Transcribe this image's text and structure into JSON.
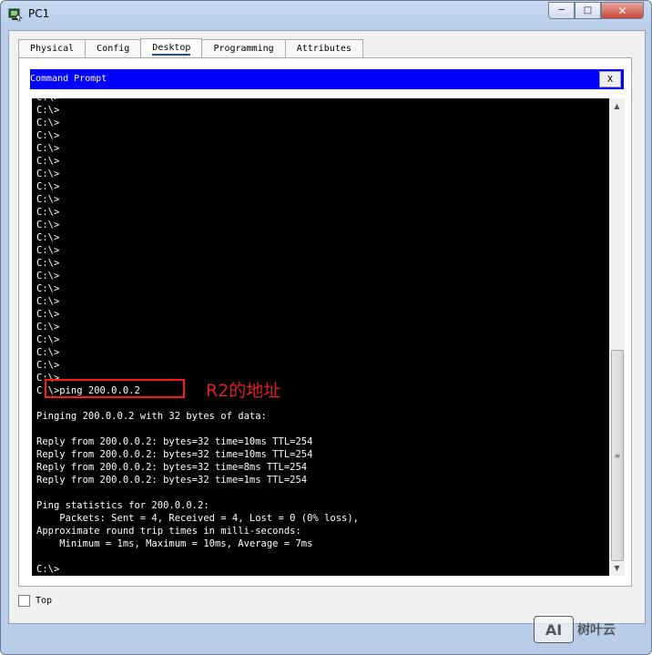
{
  "window": {
    "title": "PC1",
    "minimize": "─",
    "maximize": "□",
    "close": "✕",
    "icon": "packet-tracer-pc-icon"
  },
  "tabs": [
    {
      "label": "Physical",
      "active": false
    },
    {
      "label": "Config",
      "active": false
    },
    {
      "label": "Desktop",
      "active": true
    },
    {
      "label": "Programming",
      "active": false
    },
    {
      "label": "Attributes",
      "active": false
    }
  ],
  "command_prompt": {
    "title": "Command Prompt",
    "close_label": "X",
    "lines": [
      "C:\\>",
      "C:\\>",
      "C:\\>",
      "C:\\>",
      "C:\\>",
      "C:\\>",
      "C:\\>",
      "C:\\>",
      "C:\\>",
      "C:\\>",
      "C:\\>",
      "C:\\>",
      "C:\\>",
      "C:\\>",
      "C:\\>",
      "C:\\>",
      "C:\\>",
      "C:\\>",
      "C:\\>",
      "C:\\>",
      "C:\\>",
      "C:\\>",
      "C:\\>",
      "C:\\>ping 200.0.0.2",
      "",
      "Pinging 200.0.0.2 with 32 bytes of data:",
      "",
      "Reply from 200.0.0.2: bytes=32 time=10ms TTL=254",
      "Reply from 200.0.0.2: bytes=32 time=10ms TTL=254",
      "Reply from 200.0.0.2: bytes=32 time=8ms TTL=254",
      "Reply from 200.0.0.2: bytes=32 time=1ms TTL=254",
      "",
      "Ping statistics for 200.0.0.2:",
      "    Packets: Sent = 4, Received = 4, Lost = 0 (0% loss),",
      "Approximate round trip times in milli-seconds:",
      "    Minimum = 1ms, Maximum = 10ms, Average = 7ms",
      "",
      "C:\\>"
    ]
  },
  "annotation": {
    "text": "R2的地址",
    "color": "#e02020"
  },
  "scrollbar": {
    "up": "▲",
    "down": "▼",
    "grip": "≡"
  },
  "top_checkbox": {
    "label": "Top",
    "checked": false
  },
  "watermark": {
    "badge": "AI",
    "text": "树叶云"
  },
  "colors": {
    "title_bar": "#0000ff",
    "terminal_bg": "#000000",
    "terminal_fg": "#ffffff",
    "tab_underline": "#1b4f9c"
  }
}
